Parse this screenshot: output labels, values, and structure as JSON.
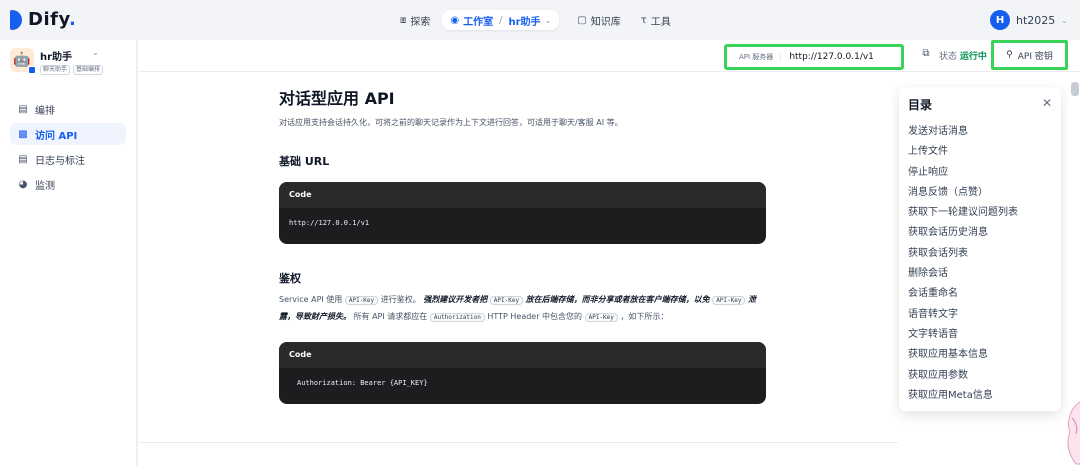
{
  "brand": {
    "name": "Dify",
    "dot": "."
  },
  "nav": {
    "explore": "探索",
    "studio": "工作室",
    "separator": "/",
    "current_app": "hr助手",
    "knowledge": "知识库",
    "tools": "工具"
  },
  "user": {
    "initial": "H",
    "name": "ht2025"
  },
  "app": {
    "name": "hr助手",
    "tags": [
      "聊天助手",
      "基础编排"
    ]
  },
  "sidebar": {
    "items": [
      {
        "label": "编排",
        "icon": "layout-icon"
      },
      {
        "label": "访问 API",
        "icon": "terminal-icon",
        "active": true
      },
      {
        "label": "日志与标注",
        "icon": "log-icon"
      },
      {
        "label": "监测",
        "icon": "monitor-icon"
      }
    ]
  },
  "header": {
    "server_label": "API 服务器",
    "server_url": "http://127.0.0.1/v1",
    "status_label": "状态",
    "status_value": "运行中",
    "api_key_label": "API 密钥"
  },
  "doc": {
    "title": "对话型应用 API",
    "subtitle": "对话应用支持会话持久化，可将之前的聊天记录作为上下文进行回答，可适用于聊天/客服 AI 等。",
    "base_url_heading": "基础 URL",
    "code_label": "Code",
    "base_url_code": "http://127.0.0.1/v1",
    "auth_heading": "鉴权",
    "auth_p1": "Service API 使用",
    "auth_code_apikey": "API-Key",
    "auth_p2": "进行鉴权。",
    "auth_em1": "强烈建议开发者把",
    "auth_em2": "放在后端存储，而非分享或者放在客户端存储，以免",
    "auth_code_apikey2": "API-Key",
    "auth_em3": "泄露，导致财产损失。",
    "auth_p3": "所有 API 请求都应在",
    "auth_code_authorization": "Authorization",
    "auth_p4": "HTTP Header 中包含您的",
    "auth_code_apikey3": "API-Key",
    "auth_p5": "，如下所示：",
    "auth_code": "Authorization: Bearer {API_KEY}"
  },
  "toc": {
    "title": "目录",
    "items": [
      "发送对话消息",
      "上传文件",
      "停止响应",
      "消息反馈（点赞）",
      "获取下一轮建议问题列表",
      "获取会话历史消息",
      "获取会话列表",
      "删除会话",
      "会话重命名",
      "语音转文字",
      "文字转语音",
      "获取应用基本信息",
      "获取应用参数",
      "获取应用Meta信息"
    ]
  },
  "colors": {
    "accent": "#155eef",
    "highlight": "#3ad359",
    "running": "#079455"
  }
}
